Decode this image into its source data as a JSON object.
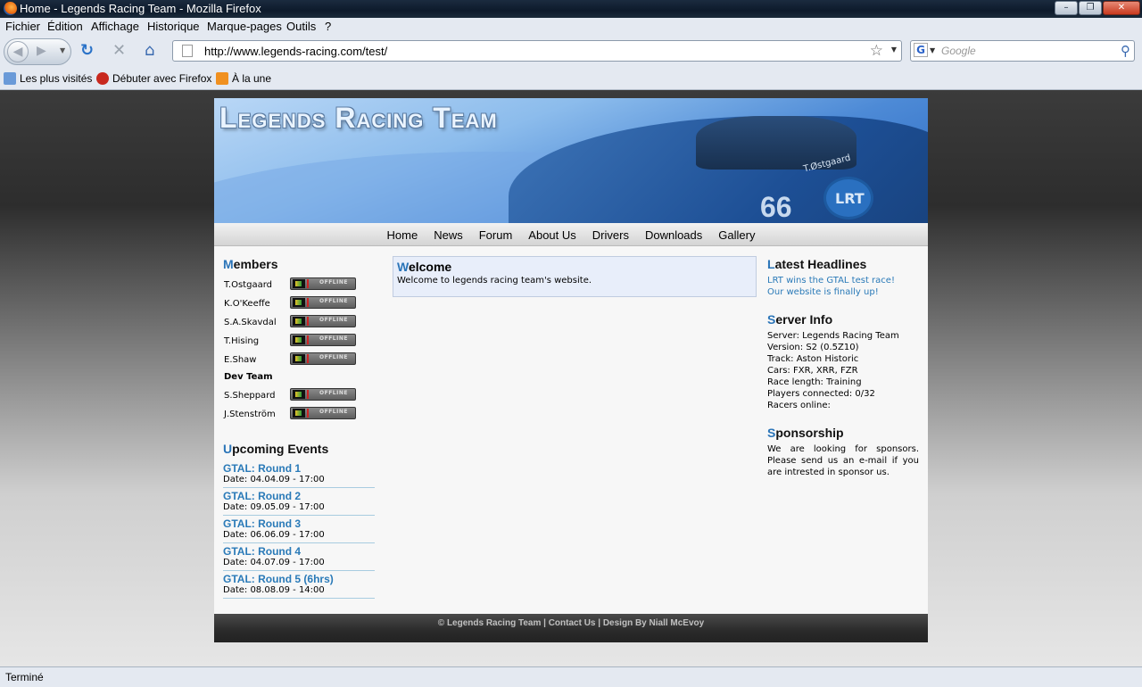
{
  "window": {
    "title": "Home - Legends Racing Team - Mozilla Firefox"
  },
  "menu": [
    "Fichier",
    "Édition",
    "Affichage",
    "Historique",
    "Marque-pages",
    "Outils",
    "?"
  ],
  "toolbar": {
    "url": "http://www.legends-racing.com/test/",
    "search_placeholder": "Google"
  },
  "bookmarks": [
    "Les plus visités",
    "Débuter avec Firefox",
    "À la une"
  ],
  "site": {
    "title": "Legends Racing Team",
    "header_driver": "T.Østgaard",
    "header_number": "66",
    "header_badge": "LRT",
    "nav": [
      "Home",
      "News",
      "Forum",
      "About Us",
      "Drivers",
      "Downloads",
      "Gallery"
    ],
    "members_title_first": "M",
    "members_title_rest": "embers",
    "members": [
      "T.Ostgaard",
      "K.O'Keeffe",
      "S.A.Skavdal",
      "T.Hising",
      "E.Shaw"
    ],
    "dev_team_label": "Dev Team",
    "dev_team": [
      "S.Sheppard",
      "J.Stenström"
    ],
    "status_text": "OFFLINE",
    "events_title_first": "U",
    "events_title_rest": "pcoming Events",
    "events": [
      {
        "name": "GTAL: Round 1",
        "date": "Date: 04.04.09 - 17:00"
      },
      {
        "name": "GTAL: Round 2",
        "date": "Date: 09.05.09 - 17:00"
      },
      {
        "name": "GTAL: Round 3",
        "date": "Date: 06.06.09 - 17:00"
      },
      {
        "name": "GTAL: Round 4",
        "date": "Date: 04.07.09 - 17:00"
      },
      {
        "name": "GTAL: Round 5 (6hrs)",
        "date": "Date: 08.08.09 - 14:00"
      }
    ],
    "welcome_title_first": "W",
    "welcome_title_rest": "elcome",
    "welcome_text": "Welcome to legends racing team's website.",
    "headlines_title_first": "L",
    "headlines_title_rest": "atest Headlines",
    "headlines": [
      "LRT wins the GTAL test race!",
      "Our website is finally up!"
    ],
    "server_title_first": "S",
    "server_title_rest": "erver Info",
    "server_info": [
      "Server: Legends Racing Team",
      "Version: S2 (0.5Z10)",
      "Track: Aston Historic",
      "Cars: FXR, XRR, FZR",
      "Race length: Training",
      "Players connected: 0/32",
      "Racers online:"
    ],
    "sponsor_title_first": "S",
    "sponsor_title_rest": "ponsorship",
    "sponsor_text": "We are looking for sponsors. Please send us an e-mail if you are intrested in sponsor us.",
    "footer": "© Legends Racing Team | Contact Us | Design By Niall McEvoy"
  },
  "statusbar": {
    "text": "Terminé"
  },
  "colors": {
    "accent": "#2a74b8",
    "link": "#2a7ab8",
    "welcome_bg": "#e8eefa"
  },
  "icons": [
    "firefox-logo-icon",
    "back-icon",
    "forward-icon",
    "reload-icon",
    "stop-icon",
    "home-icon",
    "bookmark-star-icon",
    "search-icon"
  ]
}
